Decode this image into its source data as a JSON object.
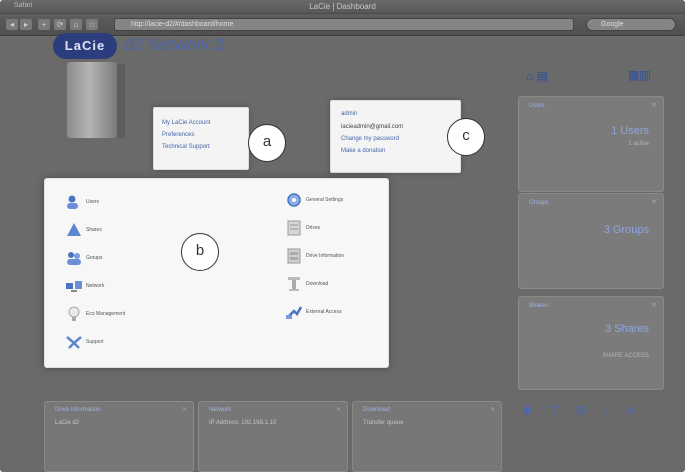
{
  "window": {
    "title": "LaCie | Dashboard",
    "left_label": "Safari"
  },
  "browser": {
    "nav": [
      "◂",
      "▸",
      "+",
      "⟳",
      "⌂",
      "☆"
    ],
    "url": "http://lacie-d2/#/dashboard/home",
    "search_placeholder": "Google"
  },
  "header": {
    "logo": "LaCie",
    "device_name": "d2 Network 2"
  },
  "popup_a": {
    "links": [
      "My LaCie Account",
      "Preferences",
      "Technical Support"
    ]
  },
  "popup_c": {
    "heading": "admin",
    "email": "lacieadmin@gmail.com",
    "links": [
      "Change my password",
      "Make a donation"
    ]
  },
  "callouts": {
    "a": "a",
    "b": "b",
    "c": "c"
  },
  "menu": {
    "left": [
      {
        "label": "Users",
        "icon": "users-icon"
      },
      {
        "label": "Shares",
        "icon": "shares-icon"
      },
      {
        "label": "Groups",
        "icon": "groups-icon"
      },
      {
        "label": "Network",
        "icon": "network-icon"
      },
      {
        "label": "Eco Management",
        "icon": "eco-icon"
      },
      {
        "label": "Support",
        "icon": "support-icon"
      }
    ],
    "right": [
      {
        "label": "General Settings",
        "icon": "settings-icon"
      },
      {
        "label": "Drives",
        "icon": "drives-icon"
      },
      {
        "label": "Drive Information",
        "icon": "drive-info-icon"
      },
      {
        "label": "Download",
        "icon": "download-icon"
      },
      {
        "label": "External Access",
        "icon": "external-access-icon"
      }
    ]
  },
  "sidebar": {
    "users": {
      "title": "Users",
      "value": "1 Users",
      "sub": "1 active"
    },
    "groups": {
      "title": "Groups",
      "value": "3 Groups",
      "sub": ""
    },
    "shares": {
      "title": "Shares",
      "value": "3 Shares",
      "sub": "SHARE ACCESS"
    }
  },
  "bottom": {
    "drive": {
      "title": "Drive Information",
      "line1": "LaCie d2"
    },
    "network": {
      "title": "Network",
      "line1": "IP Address: 192.168.1.10"
    },
    "download": {
      "title": "Download",
      "line1": "Transfer queue"
    }
  },
  "colors": {
    "accent": "#4466aa",
    "logo_bg": "#2c3d7d"
  }
}
